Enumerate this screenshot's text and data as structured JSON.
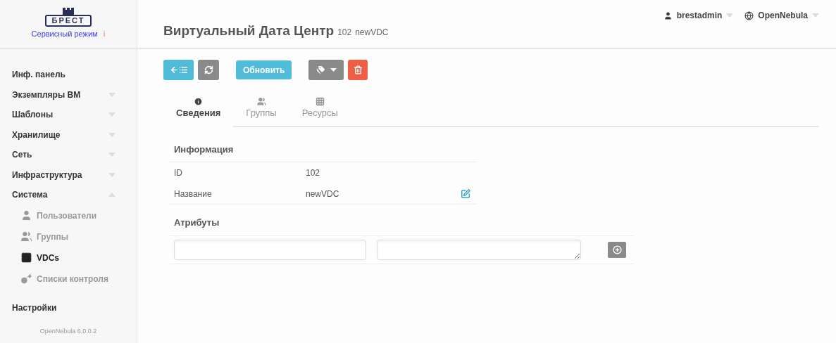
{
  "brand": {
    "logo_text": "БРЕСТ",
    "mode": "Сервисный режим",
    "mode_info": "i"
  },
  "sidebar": {
    "items": [
      {
        "label": "Инф. панель",
        "kind": "link"
      },
      {
        "label": "Экземпляры ВМ",
        "kind": "group",
        "expanded": false
      },
      {
        "label": "Шаблоны",
        "kind": "group",
        "expanded": false
      },
      {
        "label": "Хранилище",
        "kind": "group",
        "expanded": false
      },
      {
        "label": "Сеть",
        "kind": "group",
        "expanded": false
      },
      {
        "label": "Инфраструктура",
        "kind": "group",
        "expanded": false
      },
      {
        "label": "Система",
        "kind": "group",
        "expanded": true,
        "children": [
          {
            "label": "Пользователи",
            "selected": false
          },
          {
            "label": "Группы",
            "selected": false
          },
          {
            "label": "VDCs",
            "selected": true
          },
          {
            "label": "Списки контроля",
            "selected": false
          }
        ]
      },
      {
        "label": "Настройки",
        "kind": "link"
      }
    ],
    "version": "OpenNebula 6.0.0.2"
  },
  "header": {
    "title": "Виртуальный Дата Центр",
    "id": "102",
    "name": "newVDC",
    "user": "brestadmin",
    "zone": "OpenNebula"
  },
  "toolbar": {
    "update_button": "Обновить"
  },
  "tabs": [
    {
      "label": "Сведения",
      "selected": true
    },
    {
      "label": "Группы",
      "selected": false
    },
    {
      "label": "Ресурсы",
      "selected": false
    }
  ],
  "info": {
    "title": "Информация",
    "rows": [
      {
        "label": "ID",
        "value": "102",
        "editable": false
      },
      {
        "label": "Название",
        "value": "newVDC",
        "editable": true
      }
    ]
  },
  "attributes": {
    "title": "Атрибуты"
  }
}
